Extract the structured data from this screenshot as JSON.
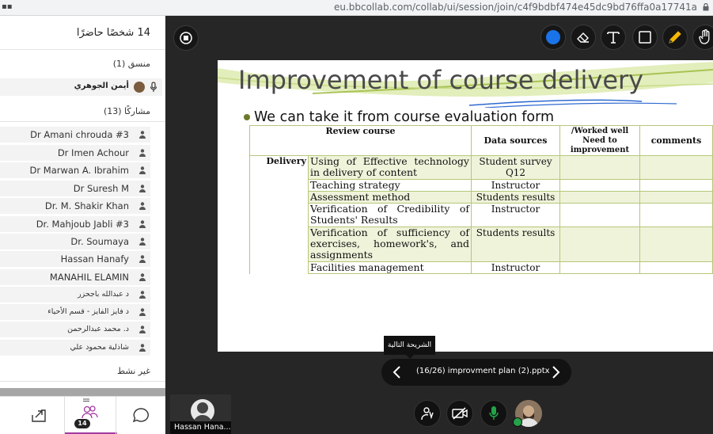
{
  "browser": {
    "url": "eu.bbcollab.com/collab/ui/session/join/c4f9bdbf474e45dc9bd76ffa0a17741a"
  },
  "panel": {
    "header": "14 شخصًا حاضرًا",
    "moderator_section": "منسق (1)",
    "moderator_name": "أيمن الجوهري",
    "participants_section": "مشاركًا (13)",
    "participants": [
      "Dr Amani chrouda #3",
      "Dr Imen Achour",
      "Dr Marwan A. Ibrahim",
      "Dr Suresh M",
      "Dr. M. Shakir Khan",
      "Dr. Mahjoub Jabli #3",
      "Dr. Soumaya",
      "Hassan Hanafy",
      "MANAHIL ELAMIN",
      "د عبدالله باجحزر",
      "د فايز الفايز - قسم الأحياء",
      "د. محمد عبدالرحمن",
      "شاذلية محمود علي"
    ],
    "inactive_section": "غير نشط",
    "nav": {
      "attendee_count": "14"
    }
  },
  "slide": {
    "title": "Improvement of course delivery",
    "bullet": "We can take it from course evaluation form",
    "table": {
      "headers": {
        "review": "Review course",
        "sources": "Data sources",
        "worked": "/Worked well Need to improvement",
        "comments": "comments"
      },
      "section_label": "Delivery",
      "rows": [
        {
          "item": "Using of Effective technology in delivery of content",
          "source": "Student survey Q12"
        },
        {
          "item": "Teaching strategy",
          "source": "Instructor"
        },
        {
          "item": "Assessment method",
          "source": "Students results"
        },
        {
          "item": "Verification of Credibility of Students' Results",
          "source": "Instructor"
        },
        {
          "item": "Verification of sufficiency of exercises, homework's, and assignments",
          "source": "Students results"
        },
        {
          "item": "Facilities management",
          "source": "Instructor"
        }
      ]
    }
  },
  "slide_nav": {
    "tooltip": "الشريحة التالية",
    "label": "(16/26)  improvment plan (2).pptx"
  },
  "video_tile": {
    "name": "Hassan Hana..."
  },
  "colors": {
    "accent_blue": "#1a73e8",
    "mic_green": "#24a348",
    "panel_accent": "#a43ba1",
    "table_shade": "#eff3da"
  }
}
